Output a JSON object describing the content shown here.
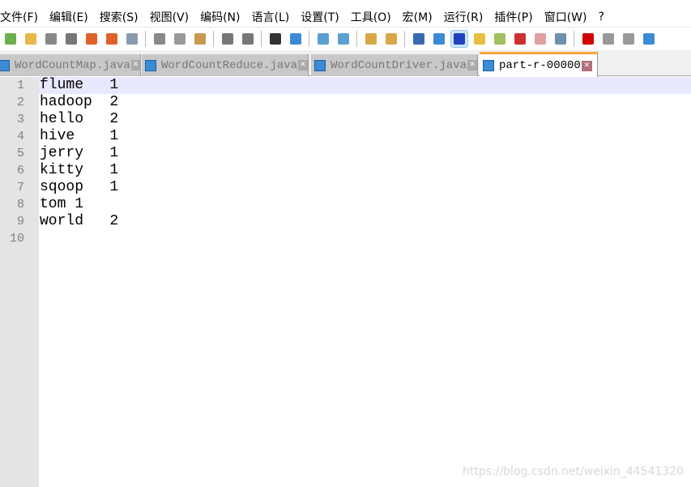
{
  "menu": [
    "文件(F)",
    "编辑(E)",
    "搜索(S)",
    "视图(V)",
    "编码(N)",
    "语言(L)",
    "设置(T)",
    "工具(O)",
    "宏(M)",
    "运行(R)",
    "插件(P)",
    "窗口(W)",
    "?"
  ],
  "toolbar": [
    {
      "icon": "new-file-icon",
      "color": "#6ab04c"
    },
    {
      "icon": "open-file-icon",
      "color": "#e8b84a"
    },
    {
      "icon": "save-icon",
      "color": "#888"
    },
    {
      "icon": "save-all-icon",
      "color": "#777"
    },
    {
      "icon": "close-icon",
      "color": "#e0602a"
    },
    {
      "icon": "close-all-icon",
      "color": "#e0602a"
    },
    {
      "icon": "print-icon",
      "color": "#8a9ab0"
    },
    "sep",
    {
      "icon": "cut-icon",
      "color": "#888"
    },
    {
      "icon": "copy-icon",
      "color": "#999"
    },
    {
      "icon": "paste-icon",
      "color": "#c89a50"
    },
    "sep",
    {
      "icon": "undo-icon",
      "color": "#777"
    },
    {
      "icon": "redo-icon",
      "color": "#777"
    },
    "sep",
    {
      "icon": "find-icon",
      "color": "#333"
    },
    {
      "icon": "replace-icon",
      "color": "#3a8ad6"
    },
    "sep",
    {
      "icon": "zoom-in-icon",
      "color": "#5aa0d0"
    },
    {
      "icon": "zoom-out-icon",
      "color": "#5aa0d0"
    },
    "sep",
    {
      "icon": "sync-vertical-icon",
      "color": "#d8a848"
    },
    {
      "icon": "sync-horizontal-icon",
      "color": "#d8a848"
    },
    "sep",
    {
      "icon": "word-wrap-icon",
      "color": "#3a6ab0"
    },
    {
      "icon": "show-all-chars-icon",
      "color": "#3a8ad6"
    },
    {
      "icon": "indent-guide-icon",
      "color": "#2040c0",
      "active": true
    },
    {
      "icon": "user-lang-icon",
      "color": "#e8c040"
    },
    {
      "icon": "doc-map-icon",
      "color": "#a0c060"
    },
    {
      "icon": "function-list-icon",
      "color": "#d03030"
    },
    {
      "icon": "folder-workspace-icon",
      "color": "#e0a0a0"
    },
    {
      "icon": "monitoring-icon",
      "color": "#7090b0"
    },
    "sep",
    {
      "icon": "record-macro-icon",
      "color": "#d00000"
    },
    {
      "icon": "stop-macro-icon",
      "color": "#999"
    },
    {
      "icon": "play-macro-icon",
      "color": "#999"
    },
    {
      "icon": "run-macro-multiple-icon",
      "color": "#3a8ad6"
    }
  ],
  "tabs": [
    {
      "label": "WordCountMap.java",
      "active": false
    },
    {
      "label": "WordCountReduce.java",
      "active": false
    },
    {
      "label": "WordCountDriver.java",
      "active": false
    },
    {
      "label": "part-r-00000",
      "active": true
    }
  ],
  "lines": [
    "flume   1",
    "hadoop  2",
    "hello   2",
    "hive    1",
    "jerry   1",
    "kitty   1",
    "sqoop   1",
    "tom 1",
    "world   2",
    ""
  ],
  "current_line": 1,
  "watermark": "https://blog.csdn.net/weixin_44541320"
}
